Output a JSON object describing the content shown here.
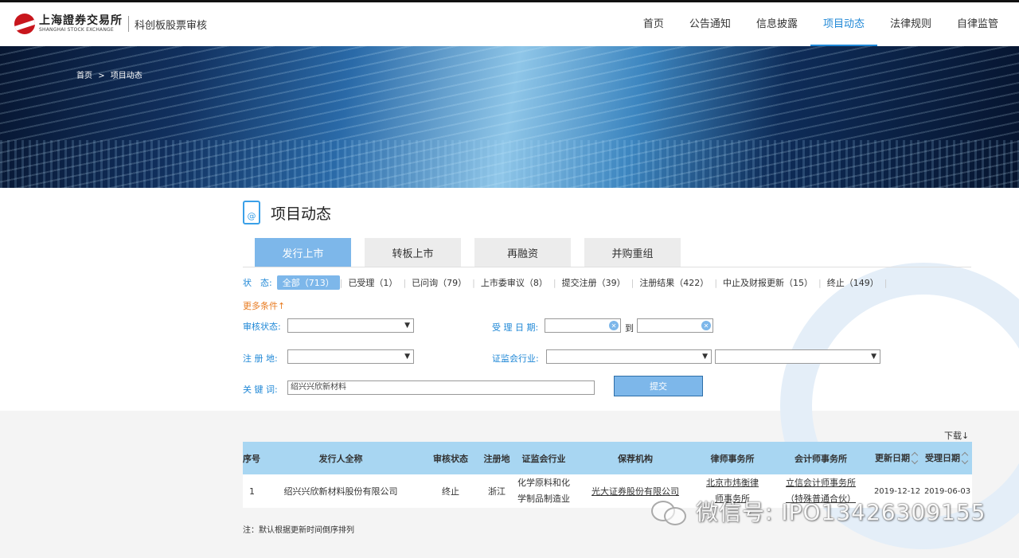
{
  "header": {
    "logo_cn": "上海證券交易所",
    "logo_en": "SHANGHAI STOCK EXCHANGE",
    "logo_sub": "科创板股票审核",
    "nav": [
      {
        "label": "首页"
      },
      {
        "label": "公告通知"
      },
      {
        "label": "信息披露"
      },
      {
        "label": "项目动态"
      },
      {
        "label": "法律规则"
      },
      {
        "label": "自律监管"
      }
    ]
  },
  "breadcrumb": {
    "home": "首页",
    "sep": ">",
    "current": "项目动态"
  },
  "page_title": "项目动态",
  "tabs": [
    {
      "label": "发行上市"
    },
    {
      "label": "转板上市"
    },
    {
      "label": "再融资"
    },
    {
      "label": "并购重组"
    }
  ],
  "status": {
    "label": "状　态:",
    "items": [
      {
        "label": "全部（713）"
      },
      {
        "label": "已受理（1）"
      },
      {
        "label": "已问询（79）"
      },
      {
        "label": "上市委审议（8）"
      },
      {
        "label": "提交注册（39）"
      },
      {
        "label": "注册结果（422）"
      },
      {
        "label": "中止及财报更新（15）"
      },
      {
        "label": "终止（149）"
      }
    ]
  },
  "more_conditions": "更多条件↑",
  "form": {
    "review_status_label": "审核状态:",
    "accept_date_label": "受 理 日 期:",
    "to_label": "到",
    "reg_place_label": "注 册 地:",
    "industry_label": "证监会行业:",
    "keyword_label": "关 键 词:",
    "keyword_value": "绍兴兴欣新材料",
    "submit_label": "提交"
  },
  "download_label": "下载↓",
  "table": {
    "headers": [
      "序号",
      "发行人全称",
      "审核状态",
      "注册地",
      "证监会行业",
      "保荐机构",
      "律师事务所",
      "会计师事务所",
      "更新日期",
      "受理日期"
    ],
    "rows": [
      {
        "index": "1",
        "issuer": "绍兴兴欣新材料股份有限公司",
        "status": "终止",
        "place": "浙江",
        "industry": "化学原料和化学制品制造业",
        "sponsor": "光大证券股份有限公司",
        "law_firm": "北京市炜衡律师事务所",
        "accounting": "立信会计师事务所（特殊普通合伙）",
        "updated": "2019-12-12",
        "accepted": "2019-06-03"
      }
    ]
  },
  "note": "注：默认根据更新时间倒序排列",
  "watermark": "微信号: IPO13426309155"
}
